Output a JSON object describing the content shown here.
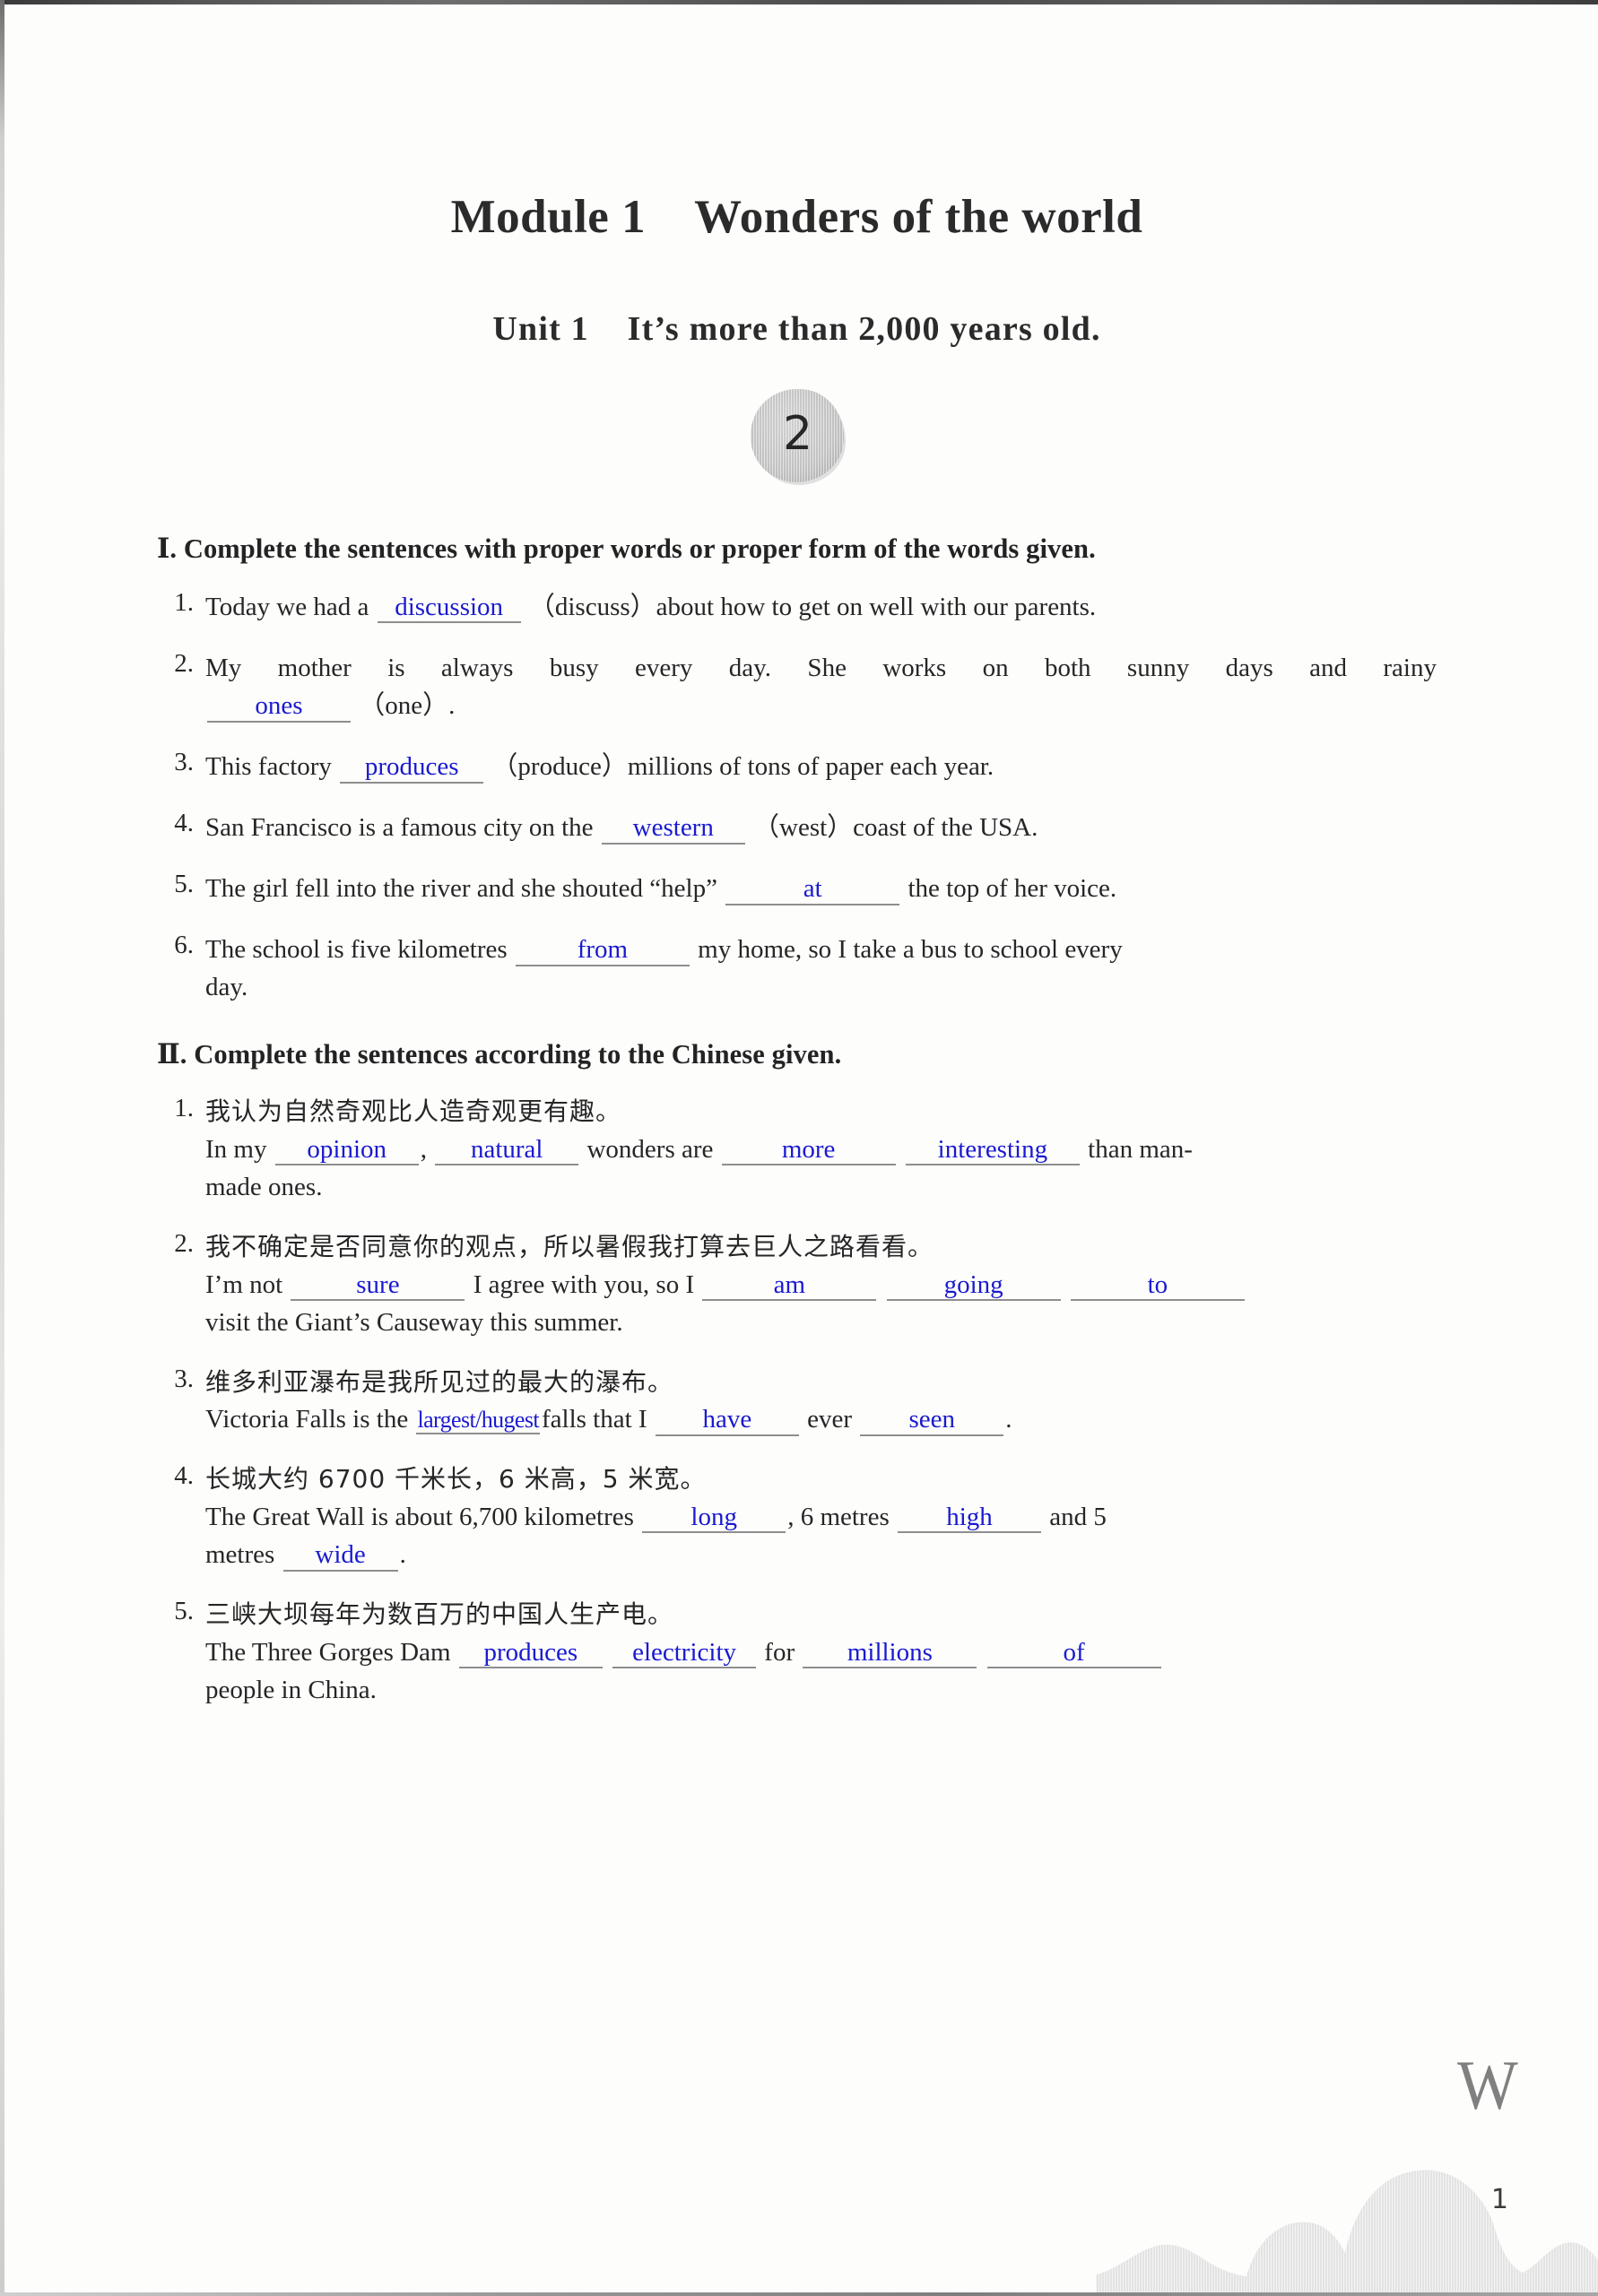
{
  "page": {
    "module_title": "Module 1    Wonders of the world",
    "unit_title": "Unit 1    It’s more than 2,000 years old.",
    "badge_number": "2",
    "watermark": "W",
    "page_number": "1",
    "answer_color": "#1a1ad0",
    "blank_rule_color": "#8e8e8e"
  },
  "sections": [
    {
      "label": "Ⅰ.",
      "heading": "Ⅰ. Complete the sentences with proper words or proper form of the words given.",
      "items": [
        {
          "num": "1.",
          "pre": "Today we had a",
          "answer": "discussion",
          "post": "（discuss）about how to get on well with our parents."
        },
        {
          "num": "2.",
          "line1": "My mother is always busy every day. She works on both sunny days and rainy",
          "answer": "ones",
          "post": "（one）."
        },
        {
          "num": "3.",
          "pre": "This factory",
          "answer": "produces",
          "post": "（produce）millions of tons of paper each year."
        },
        {
          "num": "4.",
          "pre": "San Francisco is a famous city on the",
          "answer": "western",
          "post": "（west）coast of the USA."
        },
        {
          "num": "5.",
          "pre": "The girl fell into the river and she shouted “help”",
          "answer": "at",
          "post": "the top of her voice."
        },
        {
          "num": "6.",
          "pre": "The school is five kilometres",
          "answer": "from",
          "post": "my home, so I take a bus to school every",
          "line2": "day."
        }
      ]
    },
    {
      "label": "Ⅱ.",
      "heading": "Ⅱ. Complete the sentences according to the Chinese given.",
      "items": [
        {
          "num": "1.",
          "chinese": "我认为自然奇观比人造奇观更有趣。",
          "t1": "In my",
          "a1": "opinion",
          "t2": ",",
          "a2": "natural",
          "t3": "wonders are",
          "a3": "more",
          "a4": "interesting",
          "t4": "than man-",
          "tail": "made ones."
        },
        {
          "num": "2.",
          "chinese": "我不确定是否同意你的观点，所以暑假我打算去巨人之路看看。",
          "t1": "I’m not",
          "a1": "sure",
          "t2": "I agree with you, so I",
          "a2": "am",
          "a3": "going",
          "a4": "to",
          "tail": "visit the Giant’s Causeway this summer."
        },
        {
          "num": "3.",
          "chinese": "维多利亚瀑布是我所见过的最大的瀑布。",
          "t1": "Victoria Falls is the",
          "a1": "largest/hugest",
          "t2": "falls that I",
          "a2": "have",
          "t3": "ever",
          "a3": "seen",
          "t4": "."
        },
        {
          "num": "4.",
          "chinese": "长城大约 6700 千米长，6 米高，5 米宽。",
          "t1": "The Great Wall is about 6,700 kilometres",
          "a1": "long",
          "t2": ", 6 metres",
          "a2": "high",
          "t3": "and 5",
          "tail_pre": "metres",
          "a3": "wide",
          "tail_post": "."
        },
        {
          "num": "5.",
          "chinese": "三峡大坝每年为数百万的中国人生产电。",
          "t1": "The  Three  Gorges  Dam",
          "a1": "produces",
          "a2": "electricity",
          "t2": "for",
          "a3": "millions",
          "a4": "of",
          "tail": "people in China."
        }
      ]
    }
  ]
}
